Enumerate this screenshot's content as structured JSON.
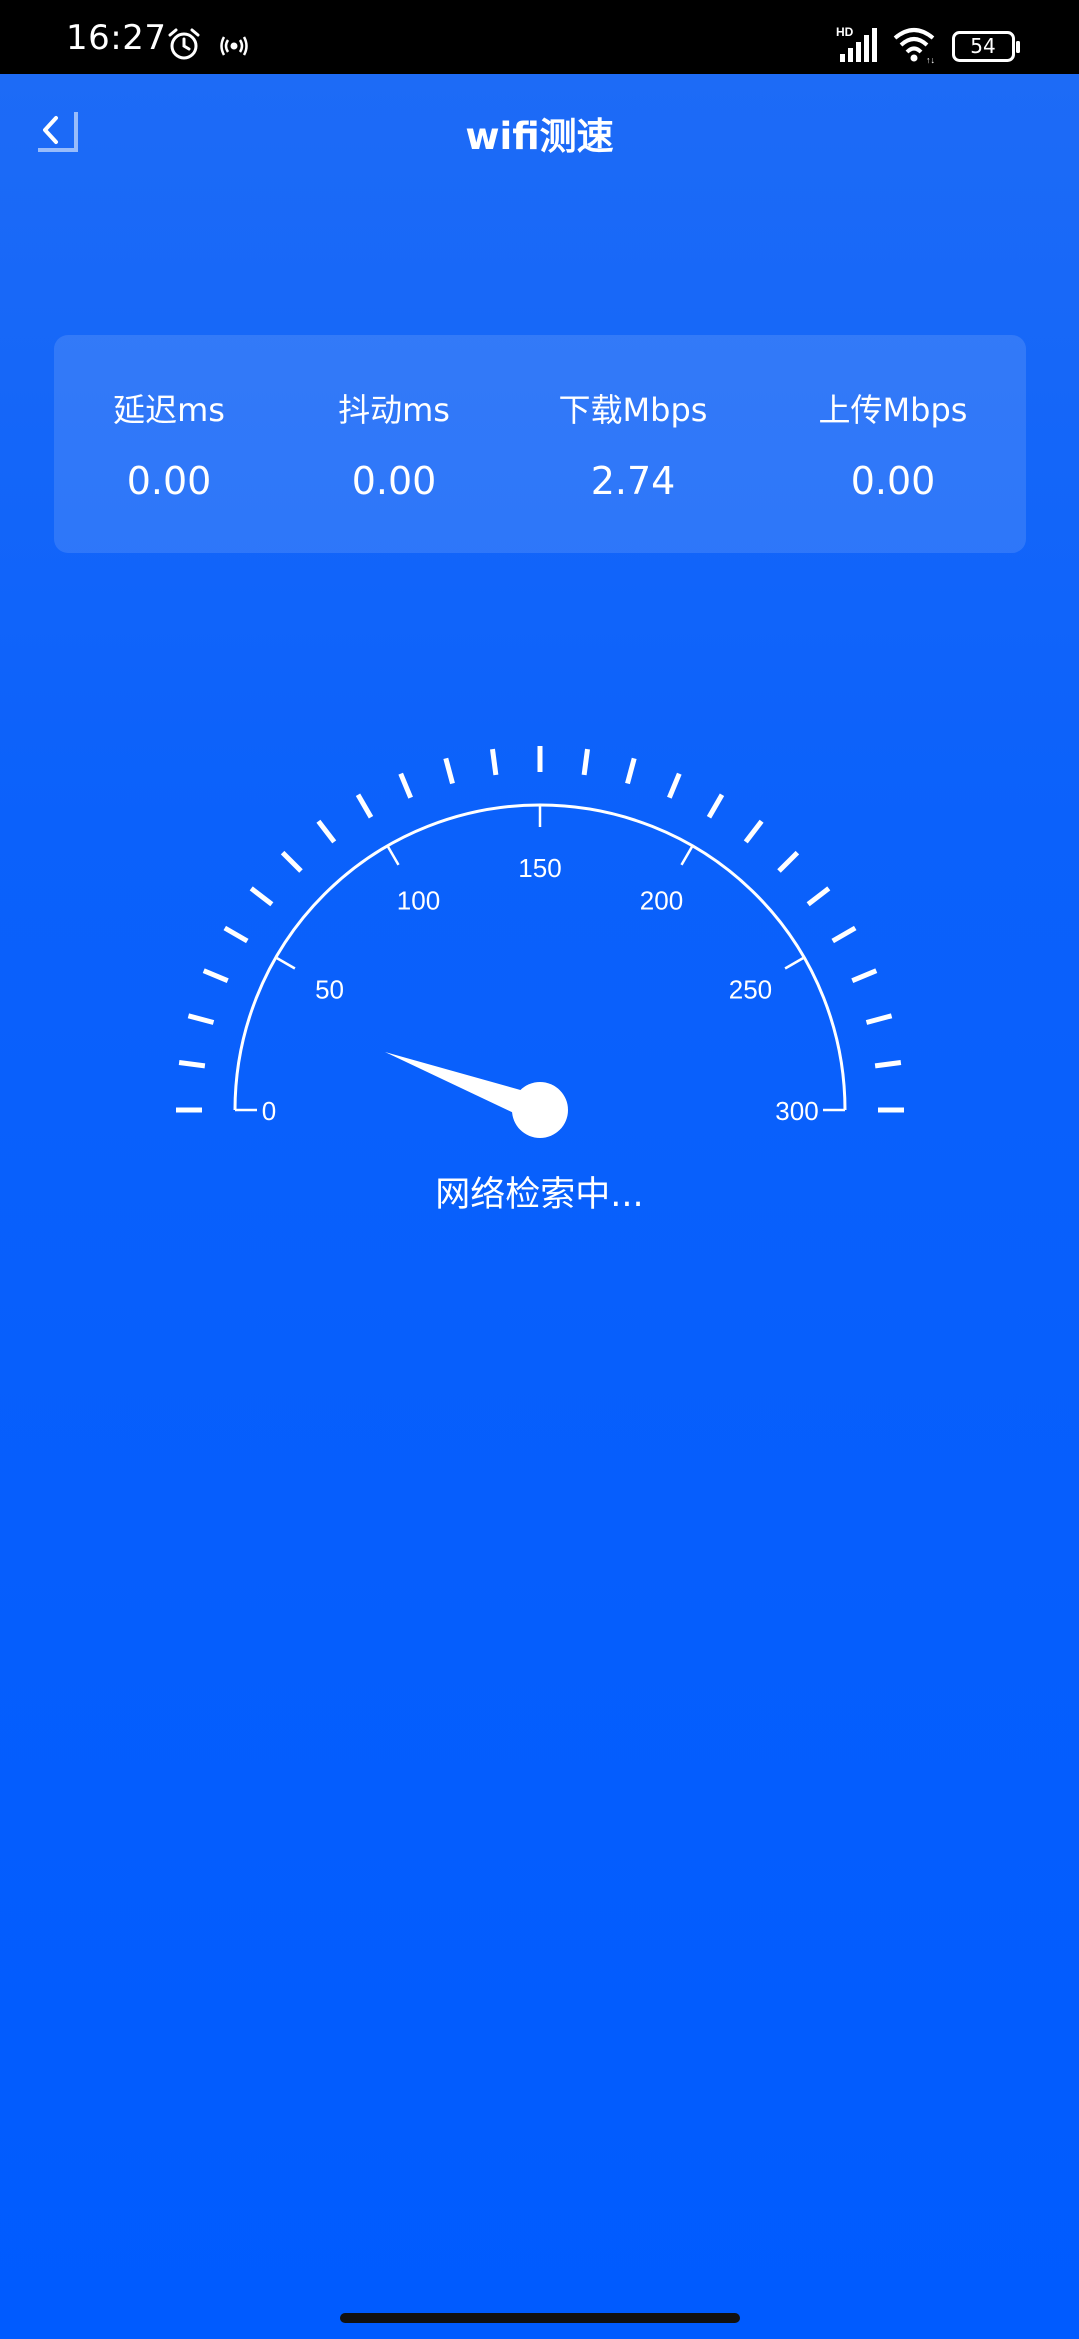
{
  "status_bar": {
    "time": "16:27",
    "battery": "54",
    "icons": [
      "alarm-icon",
      "nfc-icon",
      "hd-signal-icon",
      "wifi-icon",
      "battery-icon"
    ]
  },
  "header": {
    "back_icon": "chevron-left-icon",
    "title": "wifi测速"
  },
  "stats": [
    {
      "label": "延迟ms",
      "value": "0.00"
    },
    {
      "label": "抖动ms",
      "value": "0.00"
    },
    {
      "label": "下载Mbps",
      "value": "2.74"
    },
    {
      "label": "上传Mbps",
      "value": "0.00"
    }
  ],
  "gauge": {
    "min": 0,
    "max": 300,
    "scale_labels": [
      "0",
      "50",
      "100",
      "150",
      "200",
      "250",
      "300"
    ],
    "current_value": 2.74,
    "status_text": "网络检索中..."
  },
  "colors": {
    "background": "#005bff",
    "status_bar": "#000000",
    "text": "#ffffff"
  }
}
